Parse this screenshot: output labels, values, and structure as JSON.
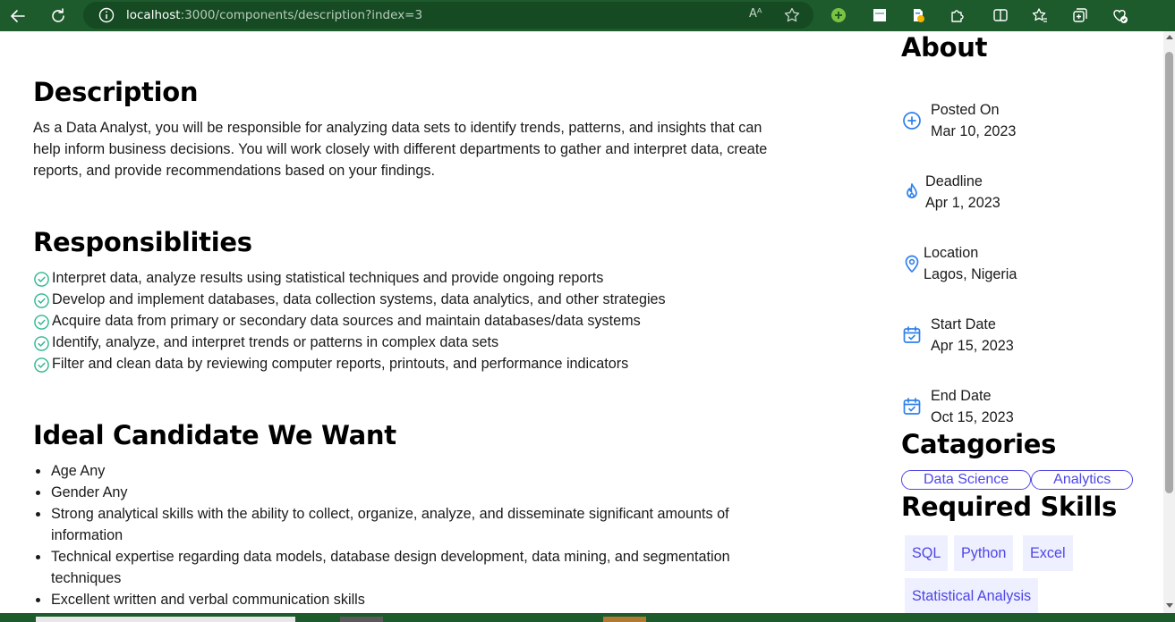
{
  "browser": {
    "url_host": "localhost",
    "url_rest": ":3000/components/description?index=3",
    "reader_label": "Aᴬ"
  },
  "description": {
    "title": "Description",
    "text": "As a Data Analyst, you will be responsible for analyzing data sets to identify trends, patterns, and insights that can help inform business decisions. You will work closely with different departments to gather and interpret data, create reports, and provide recommendations based on your findings."
  },
  "responsibilities": {
    "title": "Responsiblities",
    "items": [
      "Interpret data, analyze results using statistical techniques and provide ongoing reports",
      "Develop and implement databases, data collection systems, data analytics, and other strategies",
      "Acquire data from primary or secondary data sources and maintain databases/data systems",
      "Identify, analyze, and interpret trends or patterns in complex data sets",
      "Filter and clean data by reviewing computer reports, printouts, and performance indicators"
    ]
  },
  "candidate": {
    "title": "Ideal Candidate We Want",
    "items": [
      "Age Any",
      "Gender Any",
      "Strong analytical skills with the ability to collect, organize, analyze, and disseminate significant amounts of information",
      "Technical expertise regarding data models, database design development, data mining, and segmentation techniques",
      "Excellent written and verbal communication skills"
    ]
  },
  "about": {
    "title": "About",
    "posted_label": "Posted On",
    "posted_value": "Mar 10, 2023",
    "deadline_label": "Deadline",
    "deadline_value": "Apr 1, 2023",
    "location_label": "Location",
    "location_value": "Lagos, Nigeria",
    "start_label": "Start Date",
    "start_value": "Apr 15, 2023",
    "end_label": "End Date",
    "end_value": "Oct 15, 2023"
  },
  "categories": {
    "title": "Catagories",
    "items": [
      "Data Science",
      "Analytics"
    ]
  },
  "skills": {
    "title": "Required Skills",
    "items": [
      "SQL",
      "Python",
      "Excel",
      "Statistical Analysis"
    ]
  },
  "colors": {
    "accent": "#4f46e5",
    "icon_blue": "#2f80ed",
    "check_green": "#2fb88e",
    "chrome_green": "#1d5a2c"
  },
  "icons": {
    "posted": "plus-circle-icon",
    "deadline": "fire-icon",
    "location": "map-pin-icon",
    "start": "calendar-check-icon",
    "end": "calendar-check-icon",
    "responsibility": "check-circle-icon"
  }
}
